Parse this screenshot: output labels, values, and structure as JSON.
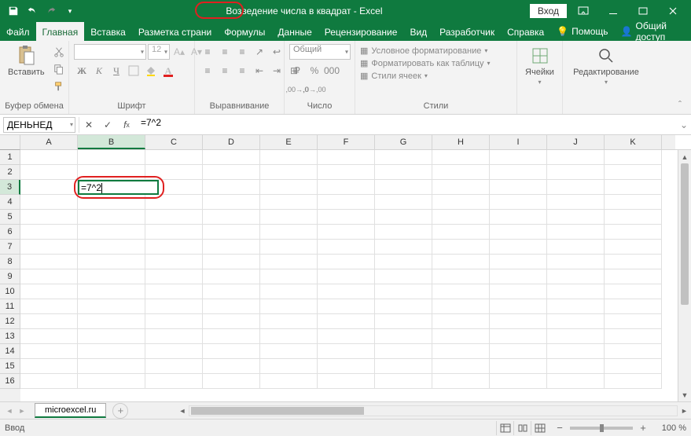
{
  "titlebar": {
    "title": "Возведение числа в квадрат  -  Excel",
    "login": "Вход"
  },
  "tabs": {
    "file": "Файл",
    "home": "Главная",
    "insert": "Вставка",
    "layout": "Разметка страни",
    "formulas": "Формулы",
    "data": "Данные",
    "review": "Рецензирование",
    "view": "Вид",
    "developer": "Разработчик",
    "help": "Справка",
    "tellme": "Помощь",
    "share": "Общий доступ"
  },
  "ribbon": {
    "clipboard": {
      "label": "Буфер обмена",
      "paste": "Вставить"
    },
    "font": {
      "label": "Шрифт",
      "name": "",
      "size": "12"
    },
    "alignment": {
      "label": "Выравнивание"
    },
    "number": {
      "label": "Число",
      "format": "Общий"
    },
    "styles": {
      "label": "Стили",
      "conditional": "Условное форматирование",
      "table": "Форматировать как таблицу",
      "cellstyles": "Стили ячеек"
    },
    "cells": {
      "label": "Ячейки"
    },
    "editing": {
      "label": "Редактирование"
    }
  },
  "formulaBar": {
    "nameBox": "ДЕНЬНЕД",
    "formula": "=7^2"
  },
  "grid": {
    "columns": [
      "A",
      "B",
      "C",
      "D",
      "E",
      "F",
      "G",
      "H",
      "I",
      "J",
      "K"
    ],
    "rows": [
      "1",
      "2",
      "3",
      "4",
      "5",
      "6",
      "7",
      "8",
      "9",
      "10",
      "11",
      "12",
      "13",
      "14",
      "15",
      "16"
    ],
    "activeCell": "=7^2",
    "activeCol": 1,
    "activeRow": 2
  },
  "sheet": {
    "name": "microexcel.ru"
  },
  "statusbar": {
    "mode": "Ввод",
    "zoom": "100 %"
  }
}
